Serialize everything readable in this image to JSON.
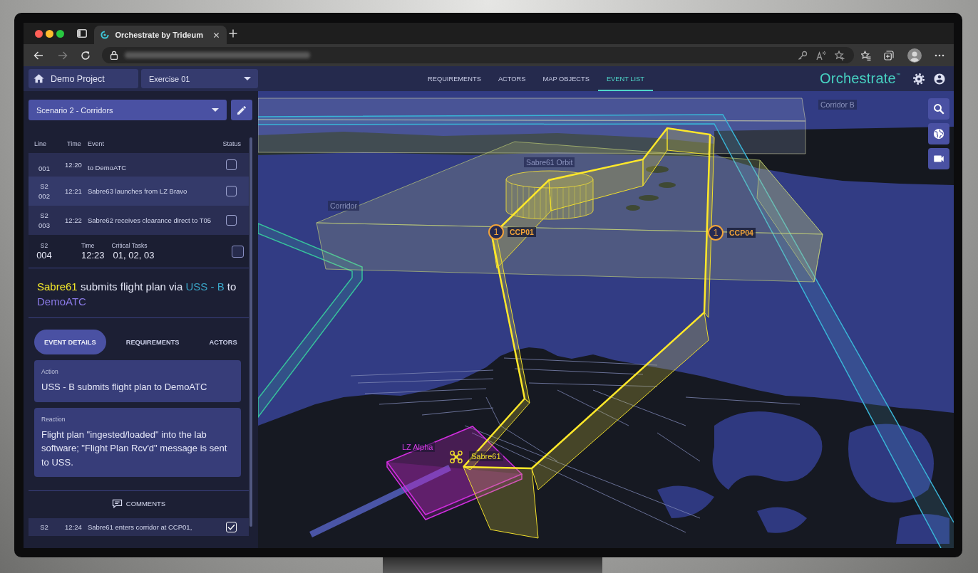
{
  "browser": {
    "tabs": [
      {
        "title": "Orchestrate by Trideum",
        "selected": true
      }
    ]
  },
  "app_header": {
    "project": "Demo Project",
    "exercise": "Exercise 01",
    "nav": [
      {
        "label": "REQUIREMENTS",
        "selected": false
      },
      {
        "label": "ACTORS",
        "selected": false
      },
      {
        "label": "MAP OBJECTS",
        "selected": false
      },
      {
        "label": "EVENT LIST",
        "selected": true
      }
    ],
    "logo": {
      "text": "Orchestrate",
      "mark": "™"
    }
  },
  "event_panel": {
    "scenario": "Scenario 2 - Corridors",
    "columns": [
      "Line",
      "Time",
      "Event",
      "Status"
    ],
    "rows": [
      {
        "number": "001",
        "time": "12:20",
        "event": "to DemoATC",
        "checked": false,
        "selected": false,
        "highlighted": false
      },
      {
        "scenario": "S2",
        "number": "002",
        "time": "12:21",
        "event": "Sabre63 launches from LZ Bravo",
        "checked": false,
        "selected": false,
        "highlighted": true
      },
      {
        "scenario": "S2",
        "number": "003",
        "time": "12:22",
        "event": "Sabre62 receives clearance direct to T05",
        "checked": false,
        "selected": false,
        "highlighted": false
      },
      {
        "scenario": "S2",
        "number": "004",
        "fields": [
          {
            "label": "Time",
            "value": "12:23"
          },
          {
            "label": "Critical Tasks",
            "value": "01, 02, 03"
          }
        ],
        "checked": false,
        "selected": true,
        "highlighted": false
      },
      {
        "scenario": "S2",
        "time": "12:24",
        "event": "Sabre61 enters corridor at CCP01,",
        "checked": true,
        "selected": false,
        "highlighted": false
      }
    ],
    "detail": {
      "description": [
        {
          "text": "Sabre61",
          "color": "#f2e62a"
        },
        {
          "text": " submits flight plan via ",
          "color": "#e2e5f5"
        },
        {
          "text": "USS - B",
          "color": "#3aa6c8"
        },
        {
          "text": " to ",
          "color": "#e2e5f5"
        },
        {
          "text": "DemoATC",
          "color": "#8a7ae6"
        }
      ],
      "tabs": [
        {
          "label": "EVENT DETAILS",
          "selected": true
        },
        {
          "label": "REQUIREMENTS",
          "selected": false
        },
        {
          "label": "ACTORS",
          "selected": false
        }
      ],
      "fields": [
        {
          "label": "Action",
          "value": "USS - B submits flight plan to DemoATC"
        },
        {
          "label": "Reaction",
          "value": "Flight plan \"ingested/loaded\" into the lab software; \"Flight Plan Rcv'd\" message is sent to USS."
        }
      ],
      "comments": "COMMENTS"
    }
  },
  "map": {
    "labels": [
      {
        "text": "Corridor B",
        "kind": "area"
      },
      {
        "text": "Sabre61 Orbit",
        "kind": "area"
      },
      {
        "text": "Corridor",
        "kind": "area"
      },
      {
        "text": "CCP01",
        "kind": "waypoint",
        "number": "1"
      },
      {
        "text": "CCP04",
        "kind": "waypoint",
        "number": "1"
      },
      {
        "text": "LZ Alpha",
        "kind": "zone"
      },
      {
        "text": "Sabre61",
        "kind": "aircraft"
      }
    ]
  }
}
